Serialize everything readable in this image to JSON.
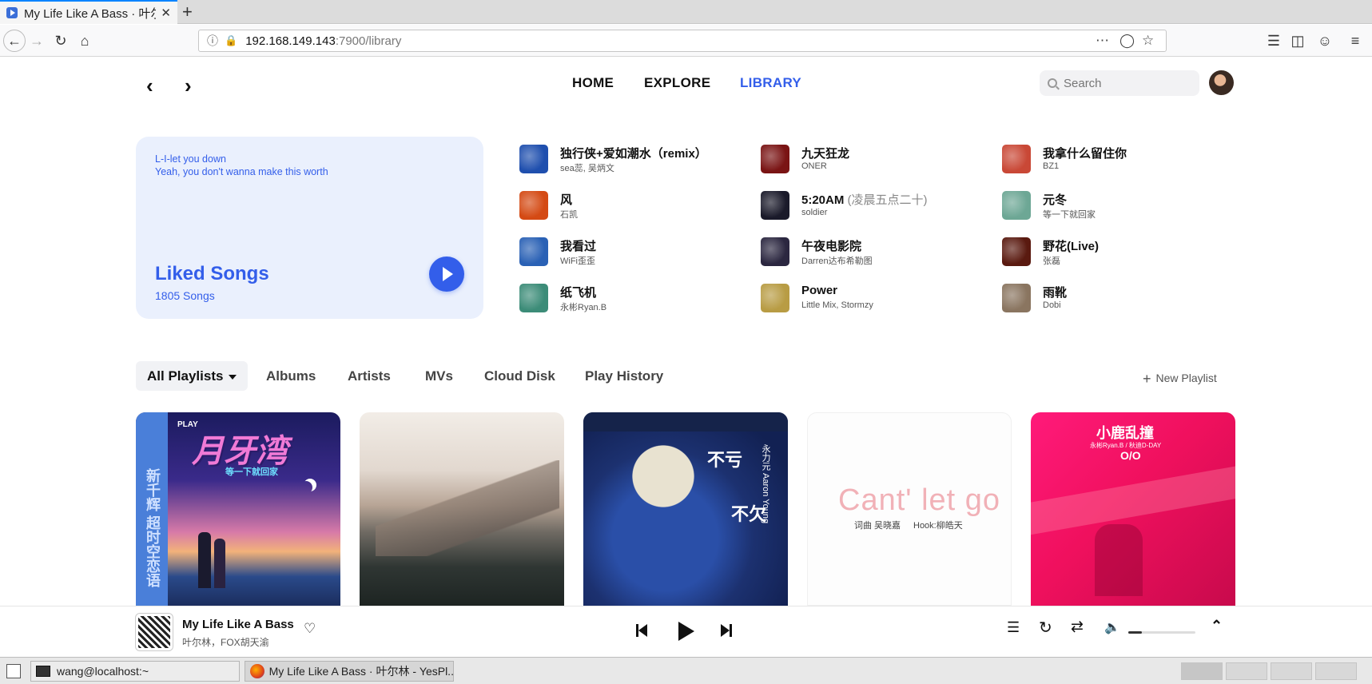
{
  "browser": {
    "tab_title": "My Life Like A Bass · 叶尔",
    "tab_close": "✕",
    "new_tab": "+",
    "url_host": "192.168.149.143",
    "url_rest": ":7900/library",
    "icons": [
      "back-icon",
      "forward-icon",
      "reload-icon",
      "home-icon",
      "info-icon",
      "insecure-icon",
      "more-icon",
      "pocket-icon",
      "bookmark-star-icon",
      "library-icon",
      "sidebar-icon",
      "account-icon",
      "menu-icon"
    ]
  },
  "header": {
    "nav": [
      "HOME",
      "EXPLORE",
      "LIBRARY"
    ],
    "active_nav": "LIBRARY",
    "search_placeholder": "Search",
    "accent": "#335eea"
  },
  "liked": {
    "lyric_lines": [
      "L-I-let you down",
      "Yeah, you don't wanna make this worth"
    ],
    "title": "Liked Songs",
    "count": "1805 Songs"
  },
  "songs": [
    {
      "name": "独行侠+爱如潮水（remix）",
      "sub": "",
      "artist": "sea蕊, 吴炳文",
      "color": "#1f4fae"
    },
    {
      "name": "九天狂龙",
      "sub": "",
      "artist": "ONER",
      "color": "#7a1414"
    },
    {
      "name": "我拿什么留住你",
      "sub": "",
      "artist": "BZ1",
      "color": "#c94836"
    },
    {
      "name": "风",
      "sub": "",
      "artist": "石凯",
      "color": "#d44a14"
    },
    {
      "name": "5:20AM",
      "sub": " (凌晨五点二十)",
      "artist": "soldier",
      "color": "#1a1a2a"
    },
    {
      "name": "元冬",
      "sub": "",
      "artist": "等一下就回家",
      "color": "#6da795"
    },
    {
      "name": "我看过",
      "sub": "",
      "artist": "WiFi歪歪",
      "color": "#2a61b5"
    },
    {
      "name": "午夜电影院",
      "sub": "",
      "artist": "Darren达布希勒图",
      "color": "#2b2740"
    },
    {
      "name": "野花(Live)",
      "sub": "",
      "artist": "张磊",
      "color": "#5a1a10"
    },
    {
      "name": "纸飞机",
      "sub": "",
      "artist": "永彬Ryan.B",
      "color": "#3c8c78"
    },
    {
      "name": "Power",
      "sub": "",
      "artist": "Little Mix, Stormzy",
      "color": "#b89c44"
    },
    {
      "name": "雨靴",
      "sub": "",
      "artist": "Dobi",
      "color": "#8a7560"
    }
  ],
  "playlist_tabs": [
    "All Playlists",
    "Albums",
    "Artists",
    "MVs",
    "Cloud Disk",
    "Play History"
  ],
  "new_playlist": "New Playlist",
  "albums": {
    "a1": {
      "side_text": "新千辉 超时空恋语",
      "play": "PLAY",
      "title": "月牙湾",
      "subtitle": "等一下就回家"
    },
    "a3": {
      "title1": "不亏",
      "title2": "不欠",
      "artist": "永力元 Aaron Young"
    },
    "a4": {
      "title": "Cant' let go",
      "credit1": "词曲 吴晓嘉",
      "credit2": "Hook:柳皓天"
    },
    "a5": {
      "title": "小鹿乱撞",
      "credit": "永彬Ryan.B / 秋迪D-DAY",
      "mark": "O/O"
    }
  },
  "player": {
    "title": "My Life Like A Bass",
    "artist": "叶尔林，FOX胡天渝",
    "volume": 0.2
  },
  "taskbar": {
    "terminal": "wang@localhost:~",
    "browser": "My Life Like A Bass · 叶尔林 - YesPl..."
  }
}
